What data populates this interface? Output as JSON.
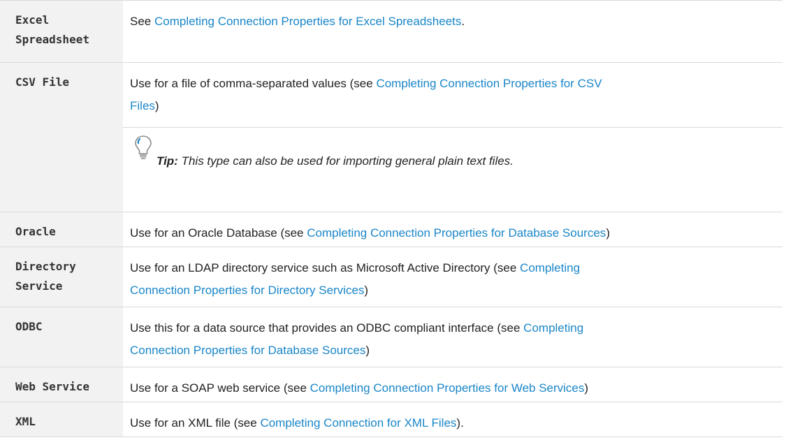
{
  "rows": [
    {
      "type": "Excel Spreadsheet",
      "type_lines": [
        "Excel",
        "Spreadsheet"
      ],
      "desc_prefix": "See ",
      "link": "Completing Connection Properties for Excel Spreadsheets",
      "desc_suffix": "."
    },
    {
      "type": "CSV File",
      "desc_prefix": "Use for a file of comma-separated values (see ",
      "link_line1": "Completing Connection Properties for CSV",
      "link_line2": "Files",
      "desc_suffix": ")",
      "tip": {
        "label": "Tip:",
        "text": " This type can also be used for importing general plain text files.",
        "icon": "lightbulb-icon"
      }
    },
    {
      "type": "Oracle",
      "desc_prefix": "Use for an Oracle Database (see ",
      "link": "Completing Connection Properties for Database Sources",
      "desc_suffix": ")"
    },
    {
      "type": "Directory Service",
      "type_lines": [
        "Directory",
        "Service"
      ],
      "desc_prefix": "Use for an LDAP directory service such as Microsoft Active Directory (see ",
      "link_line1": "Completing",
      "link_line2": "Connection Properties for Directory Services",
      "desc_suffix": ")"
    },
    {
      "type": "ODBC",
      "desc_prefix": "Use this for a data source that provides an ODBC compliant interface (see ",
      "link_line1": "Completing",
      "link_line2": "Connection Properties for Database Sources",
      "desc_suffix": ")"
    },
    {
      "type": "Web Service",
      "desc_prefix": "Use for a SOAP web service (see ",
      "link": "Completing Connection Properties for Web Services",
      "desc_suffix": ")"
    },
    {
      "type": "XML",
      "desc_prefix": "Use for an XML file (see ",
      "link": "Completing Connection for XML Files",
      "desc_suffix": ")."
    }
  ],
  "colors": {
    "link": "#1a86c8",
    "type_column_bg": "#f2f2f2",
    "border": "#d9d9d9"
  }
}
